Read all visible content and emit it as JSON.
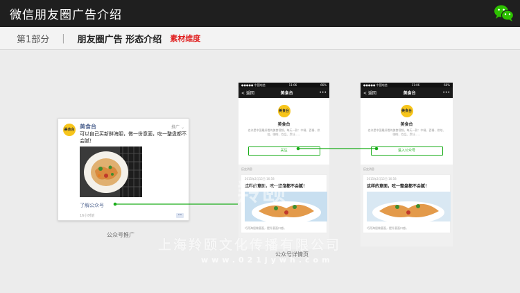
{
  "header": {
    "title": "微信朋友圈广告介绍",
    "logo_icon": "wechat-icon"
  },
  "subheader": {
    "part": "第1部分",
    "section": "朋友圈广告 形态介绍",
    "tag": "素材维度"
  },
  "ad_card": {
    "account_name": "美食台",
    "avatar_text": "美食台",
    "promo_label": "推广",
    "copy": "可以自己买新鲜海胆，做一份意面，吃一整盘都不会腻！",
    "link_text": "了解公众号",
    "time": "16小时前",
    "caption": "公众号推广"
  },
  "profile_phone": {
    "status_left": "●●●●● 中国电信",
    "status_time": "11:06",
    "status_right": "66%",
    "back_label": "< 返回",
    "nav_title": "美食台",
    "more_icon": "•••",
    "account_name": "美食台",
    "description": "也许是中国最好看的美食视频。每天一款：中餐、西餐、烘焙、咖啡、饮品、烹饪……",
    "follow_button": "关注",
    "enter_button": "进入公众号",
    "history_label": "历史消息",
    "article_date": "2015年2月15日 16:58",
    "article_title": "这样的意面，吃一整盘都不会腻！",
    "article_sub": "巧用海胆做意面，提升意面口感。",
    "caption": "公众号详情页"
  },
  "watermark": {
    "company": "上海羚颐文化传播有限公司",
    "url": "www.021jywh.com",
    "logo": "羚颐"
  },
  "colors": {
    "connector": "#1aad19",
    "link": "#576b95",
    "brand_yellow": "#f7c51b",
    "header_bg": "#1f1f1f"
  }
}
